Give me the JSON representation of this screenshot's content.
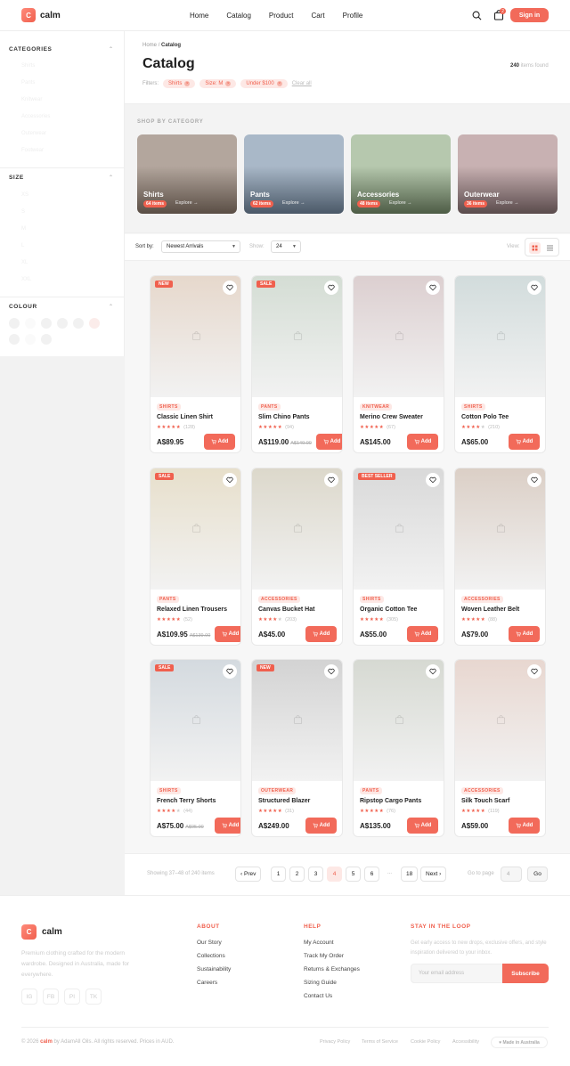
{
  "brand": {
    "name": "calm",
    "mark": "C"
  },
  "header": {
    "nav": [
      "Home",
      "Catalog",
      "Product",
      "Cart",
      "Profile"
    ],
    "cart_count": "2",
    "signin_label": "Sign in"
  },
  "sidebar": {
    "categories_title": "CATEGORIES",
    "category_items": [
      "Shirts",
      "Pants",
      "Knitwear",
      "Accessories",
      "Outerwear",
      "Footwear"
    ],
    "size_title": "SIZE",
    "size_items": [
      "XS",
      "S",
      "M",
      "L",
      "XL",
      "XXL"
    ],
    "colour_title": "COLOUR"
  },
  "breadcrumb": {
    "home": "Home",
    "sep": "/",
    "current": "Catalog"
  },
  "page": {
    "title": "Catalog",
    "count_num": "240",
    "count_text": " items found"
  },
  "filters": {
    "label": "Filters:",
    "chips": [
      "Shirts",
      "Size: M",
      "Under $100"
    ],
    "clear_label": "Clear all"
  },
  "shop_by": {
    "title": "SHOP BY CATEGORY",
    "cards": [
      {
        "name": "Shirts",
        "count": "64 items",
        "explore": "Explore →",
        "color_top": "#b3a69d",
        "color_bottom": "#5a4e45"
      },
      {
        "name": "Pants",
        "count": "62 items",
        "explore": "Explore →",
        "color_top": "#a9b8c8",
        "color_bottom": "#4a5867"
      },
      {
        "name": "Accessories",
        "count": "48 items",
        "explore": "Explore →",
        "color_top": "#b6c8ae",
        "color_bottom": "#4d5c45"
      },
      {
        "name": "Outerwear",
        "count": "36 items",
        "explore": "Explore →",
        "color_top": "#c8b1b2",
        "color_bottom": "#5a4b4c"
      }
    ]
  },
  "toolbar": {
    "sort_label": "Sort by:",
    "sort_value": "Newest Arrivals",
    "show_label": "Show:",
    "show_value": "24",
    "view_label": "View:"
  },
  "products": [
    {
      "badge": "NEW",
      "category": "SHIRTS",
      "name": "Classic Linen Shirt",
      "rating": 5,
      "reviews": "(128)",
      "price": "A$89.95",
      "old_price": "",
      "color": "#e6d8cc"
    },
    {
      "badge": "SALE",
      "category": "PANTS",
      "name": "Slim Chino Pants",
      "rating": 5,
      "reviews": "(94)",
      "price": "A$119.00",
      "old_price": "A$149.00",
      "color": "#d4ddd4"
    },
    {
      "badge": "",
      "category": "KNITWEAR",
      "name": "Merino Crew Sweater",
      "rating": 5,
      "reviews": "(67)",
      "price": "A$145.00",
      "old_price": "",
      "color": "#dccfd0"
    },
    {
      "badge": "",
      "category": "SHIRTS",
      "name": "Cotton Polo Tee",
      "rating": 4,
      "reviews": "(210)",
      "price": "A$65.00",
      "old_price": "",
      "color": "#d2dcdc"
    },
    {
      "badge": "SALE",
      "category": "PANTS",
      "name": "Relaxed Linen Trousers",
      "rating": 5,
      "reviews": "(52)",
      "price": "A$109.95",
      "old_price": "A$139.00",
      "color": "#e7dfcb"
    },
    {
      "badge": "",
      "category": "ACCESSORIES",
      "name": "Canvas Bucket Hat",
      "rating": 4,
      "reviews": "(203)",
      "price": "A$45.00",
      "old_price": "",
      "color": "#dcd8cb"
    },
    {
      "badge": "BEST SELLER",
      "category": "SHIRTS",
      "name": "Organic Cotton Tee",
      "rating": 5,
      "reviews": "(305)",
      "price": "A$55.00",
      "old_price": "",
      "color": "#d9d9d9"
    },
    {
      "badge": "",
      "category": "ACCESSORIES",
      "name": "Woven Leather Belt",
      "rating": 5,
      "reviews": "(88)",
      "price": "A$79.00",
      "old_price": "",
      "color": "#dbcfc6"
    },
    {
      "badge": "SALE",
      "category": "SHIRTS",
      "name": "French Terry Shorts",
      "rating": 4,
      "reviews": "(44)",
      "price": "A$75.00",
      "old_price": "A$95.00",
      "color": "#d4dadf"
    },
    {
      "badge": "NEW",
      "category": "OUTERWEAR",
      "name": "Structured Blazer",
      "rating": 5,
      "reviews": "(31)",
      "price": "A$249.00",
      "old_price": "",
      "color": "#d3d3d3"
    },
    {
      "badge": "",
      "category": "PANTS",
      "name": "Ripstop Cargo Pants",
      "rating": 5,
      "reviews": "(76)",
      "price": "A$135.00",
      "old_price": "",
      "color": "#d6d9d2"
    },
    {
      "badge": "",
      "category": "ACCESSORIES",
      "name": "Silk Touch Scarf",
      "rating": 5,
      "reviews": "(119)",
      "price": "A$59.00",
      "old_price": "",
      "color": "#e8d7d0"
    }
  ],
  "add_label": "Add",
  "pagination": {
    "info": "Showing 37–48 of 240 items",
    "prev": "Prev",
    "pages": [
      "1",
      "2",
      "3",
      "4",
      "5",
      "6"
    ],
    "active": "4",
    "dots": "...",
    "last": "18",
    "next": "Next",
    "goto_label": "Go to page",
    "goto_value": "4",
    "go_label": "Go"
  },
  "footer": {
    "desc": "Premium clothing crafted for the modern wardrobe. Designed in Australia, made for everywhere.",
    "social": [
      "IG",
      "FB",
      "PI",
      "TK"
    ],
    "about_title": "ABOUT",
    "about_links": [
      "Our Story",
      "Collections",
      "Sustainability",
      "Careers"
    ],
    "help_title": "HELP",
    "help_links": [
      "My Account",
      "Track My Order",
      "Returns & Exchanges",
      "Sizing Guide",
      "Contact Us"
    ],
    "news_title": "STAY IN THE LOOP",
    "news_text": "Get early access to new drops, exclusive offers, and style inspiration delivered to your inbox.",
    "email_placeholder": "Your email address",
    "subscribe_label": "Subscribe",
    "copy_pre": "© 2026 ",
    "copy_post": " by AdamAll Oils. All rights reserved. Prices in AUD.",
    "legal": [
      "Privacy Policy",
      "Terms of Service",
      "Cookie Policy",
      "Accessibility"
    ],
    "made_in": "♥ Made in Australia"
  },
  "colors": {
    "accent": "#f26a5a",
    "accent_soft": "#fde8e5"
  }
}
